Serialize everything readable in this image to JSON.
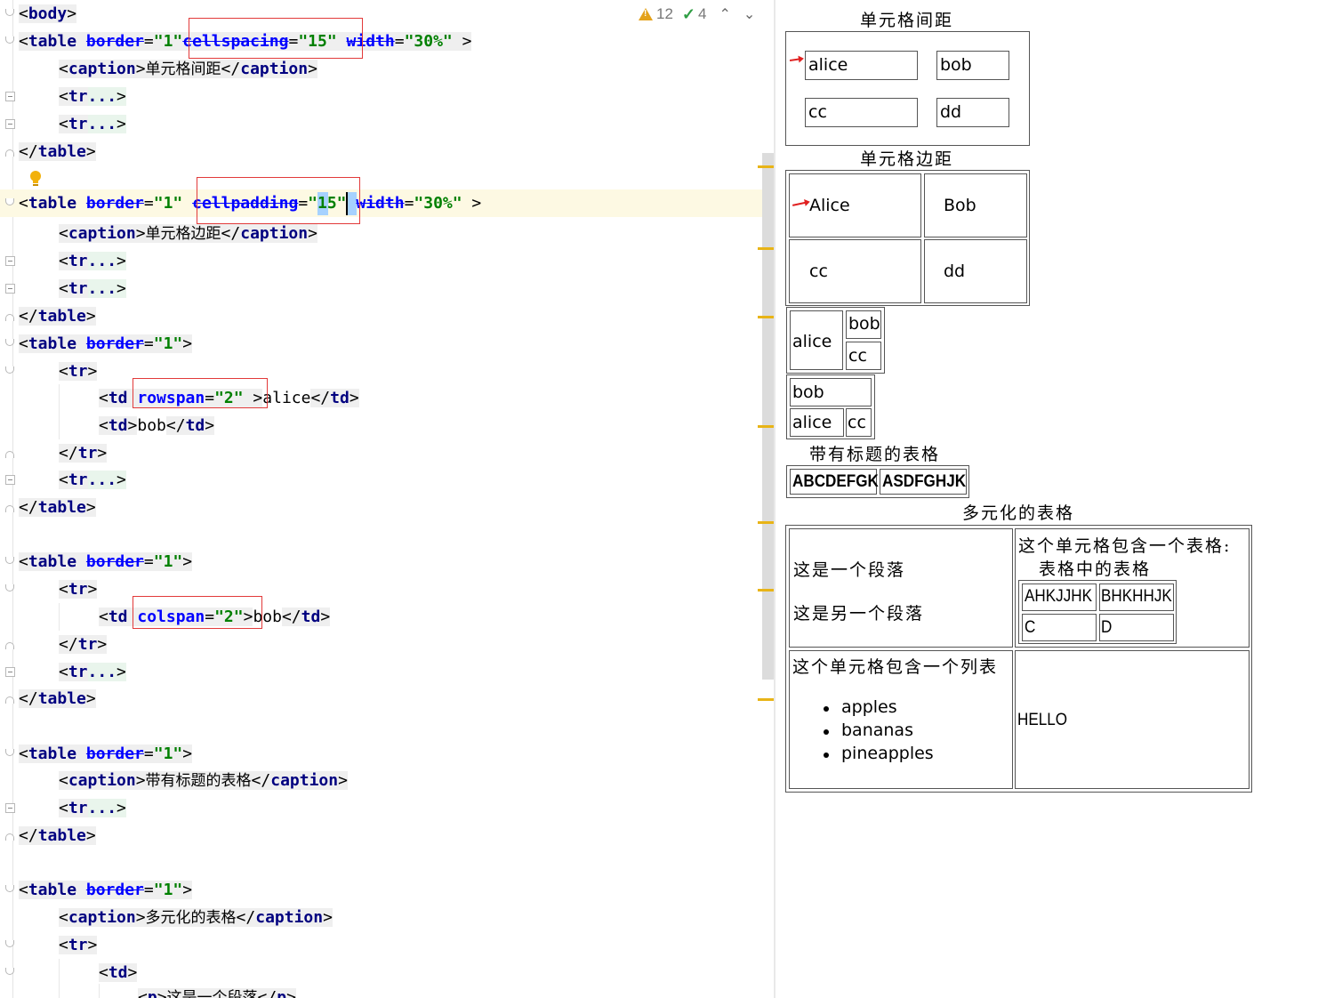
{
  "inspection": {
    "warnings": "12",
    "weak_warnings": "4"
  },
  "editor": {
    "lines": [
      {
        "id": "l0",
        "text": "<body>"
      },
      {
        "id": "l1",
        "text": "<table border=\"1\" cellspacing=\"15\" width=\"30%\" >"
      },
      {
        "id": "l2",
        "text": "<caption>单元格间距</caption>"
      },
      {
        "id": "l3",
        "text": "<tr...>"
      },
      {
        "id": "l4",
        "text": "<tr...>"
      },
      {
        "id": "l5",
        "text": "</table>"
      },
      {
        "id": "l7",
        "text": "<table border=\"1\" cellpadding=\"15\" width=\"30%\" >"
      },
      {
        "id": "l8",
        "text": "<caption>单元格边距</caption>"
      },
      {
        "id": "l9",
        "text": "<tr...>"
      },
      {
        "id": "l10",
        "text": "<tr...>"
      },
      {
        "id": "l11",
        "text": "</table>"
      },
      {
        "id": "l12",
        "text": "<table border=\"1\">"
      },
      {
        "id": "l13",
        "text": "<tr>"
      },
      {
        "id": "l14",
        "text": "<td rowspan=\"2\" >alice</td>"
      },
      {
        "id": "l15",
        "text": "<td>bob</td>"
      },
      {
        "id": "l16",
        "text": "</tr>"
      },
      {
        "id": "l17",
        "text": "<tr...>"
      },
      {
        "id": "l18",
        "text": "</table>"
      },
      {
        "id": "l20",
        "text": "<table border=\"1\">"
      },
      {
        "id": "l21",
        "text": "<tr>"
      },
      {
        "id": "l22",
        "text": "<td colspan=\"2\">bob</td>"
      },
      {
        "id": "l23",
        "text": "</tr>"
      },
      {
        "id": "l24",
        "text": "<tr...>"
      },
      {
        "id": "l25",
        "text": "</table>"
      },
      {
        "id": "l27",
        "text": "<table border=\"1\">"
      },
      {
        "id": "l28",
        "text": "<caption>带有标题的表格</caption>"
      },
      {
        "id": "l29",
        "text": "<tr...>"
      },
      {
        "id": "l30",
        "text": "</table>"
      },
      {
        "id": "l32",
        "text": "<table border=\"1\">"
      },
      {
        "id": "l33",
        "text": "<caption>多元化的表格</caption>"
      },
      {
        "id": "l34",
        "text": "<tr>"
      },
      {
        "id": "l35",
        "text": "<td>"
      },
      {
        "id": "l36",
        "text": "<p>这是一个段落</p>"
      }
    ]
  },
  "preview": {
    "t1": {
      "caption": "单元格间距",
      "cells": [
        "alice",
        "bob",
        "cc",
        "dd"
      ]
    },
    "t2": {
      "caption": "单元格边距",
      "cells": [
        "Alice",
        "Bob",
        "cc",
        "dd"
      ]
    },
    "t3": {
      "cells": [
        "alice",
        "bob",
        "cc"
      ]
    },
    "t4": {
      "cells": [
        "bob",
        "alice",
        "cc"
      ]
    },
    "t5": {
      "caption": "带有标题的表格",
      "cells": [
        "ABCDEFGK",
        "ASDFGHJK"
      ]
    },
    "t6": {
      "caption": "多元化的表格",
      "para1": "这是一个段落",
      "para2": "这是另一个段落",
      "nested_title_1": "这个单元格包含一个表格:",
      "nested_title_2": "表格中的表格",
      "nested_cells": [
        "AHKJJHK",
        "BHKHHJK",
        "C",
        "D"
      ],
      "list_title": "这个单元格包含一个列表",
      "list_items": [
        "apples",
        "bananas",
        "pineapples"
      ],
      "hello": "HELLO"
    }
  },
  "colors": {
    "highlight_box": "#e23a3a",
    "marker": "#e8b417",
    "tag": "#000080",
    "attr": "#0000ff",
    "value": "#008000"
  }
}
